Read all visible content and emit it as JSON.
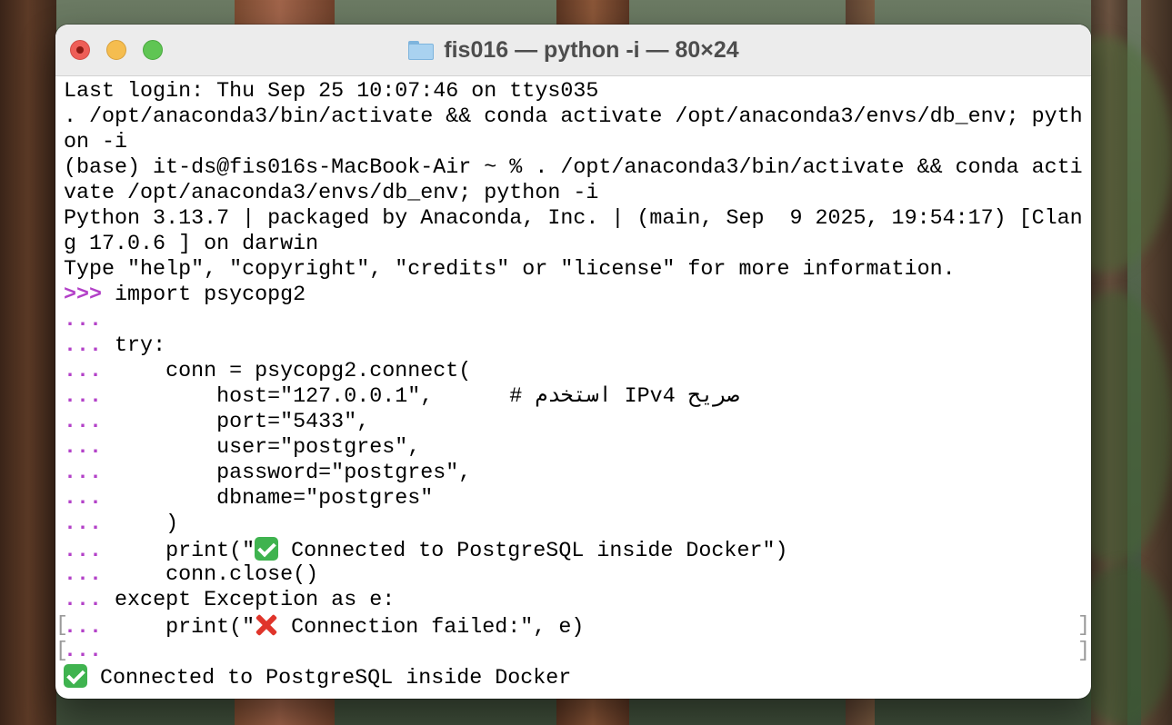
{
  "window": {
    "title": "fis016 — python -i — 80×24"
  },
  "terminal": {
    "prompt_primary": ">>>",
    "prompt_continuation": "...",
    "lines": {
      "l01": "Last login: Thu Sep 25 10:07:46 on ttys035",
      "l02": ". /opt/anaconda3/bin/activate && conda activate /opt/anaconda3/envs/db_env; pyth",
      "l03": "on -i",
      "l04": "(base) it-ds@fis016s-MacBook-Air ~ % . /opt/anaconda3/bin/activate && conda acti",
      "l05": "vate /opt/anaconda3/envs/db_env; python -i",
      "l06": "Python 3.13.7 | packaged by Anaconda, Inc. | (main, Sep  9 2025, 19:54:17) [Clan",
      "l07": "g 17.0.6 ] on darwin",
      "l08": "Type \"help\", \"copyright\", \"credits\" or \"license\" for more information.",
      "l09": " import psycopg2",
      "l10": "",
      "l11": " try:",
      "l12": "     conn = psycopg2.connect(",
      "l13": "         host=\"127.0.0.1\",      # استخدم IPv4 صريح",
      "l14": "         port=\"5433\",",
      "l15": "         user=\"postgres\",",
      "l16": "         password=\"postgres\",",
      "l17": "         dbname=\"postgres\"",
      "l18": "     )",
      "l19a": "     print(\"",
      "l19b": "Connected to PostgreSQL inside Docker\")",
      "l20": "     conn.close()",
      "l21": " except Exception as e:",
      "l22a": "     print(\"",
      "l22b": "Connection failed:\", e)",
      "l23": "",
      "l24": "Connected to PostgreSQL inside Docker"
    },
    "mark_left": "[",
    "mark_right": "]"
  },
  "icons": {
    "title_icon": "folder-icon",
    "check_emoji": "check-mark-button-icon",
    "cross_emoji": "cross-mark-icon"
  },
  "colors": {
    "prompt": "#b341c8",
    "titlebar": "#ececec",
    "close": "#ee5e57",
    "minimize": "#f5bd4f",
    "zoom": "#5fc553"
  }
}
